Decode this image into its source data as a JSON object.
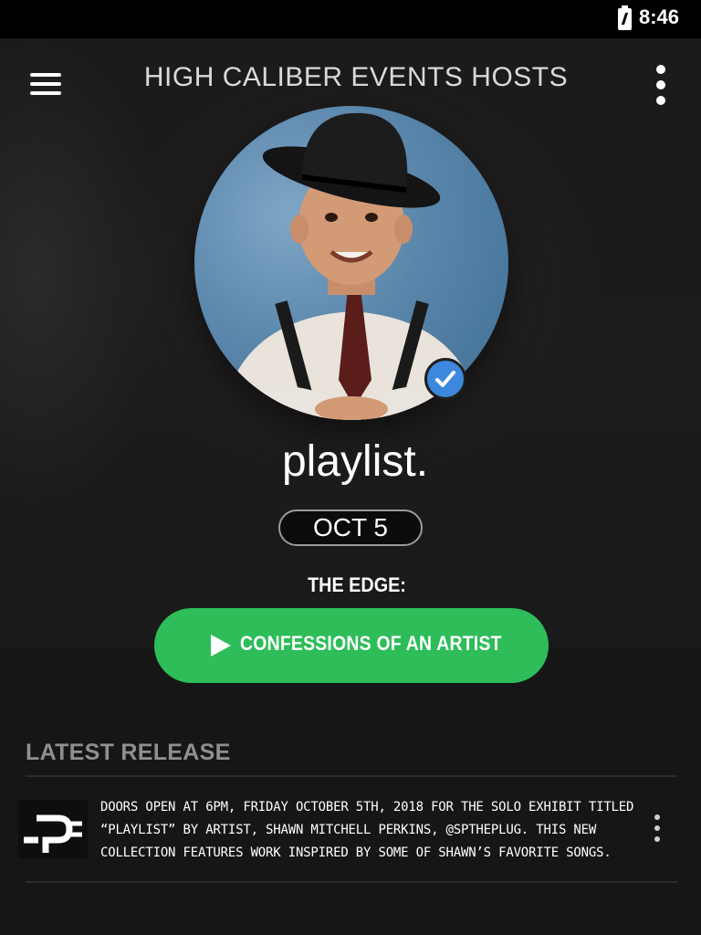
{
  "status_bar": {
    "time": "8:46",
    "battery_icon": "battery-charging-icon"
  },
  "toolbar": {
    "title": "HIGH CALIBER EVENTS HOSTS",
    "menu_icon": "hamburger-menu-icon",
    "more_icon": "more-vertical-icon"
  },
  "profile": {
    "name": "playlist.",
    "verified": true,
    "date": "OCT 5",
    "venue": "THE EDGE:",
    "cta_label": "CONFESSIONS OF AN ARTIST",
    "cta_color": "#2ebd59",
    "verified_color": "#3d88dc"
  },
  "latest_release": {
    "section_title": "LATEST RELEASE",
    "item": {
      "description": "Doors open at 6PM, friday october 5th, 2018 for the solo exhibit titled “playlist” by artist, Shawn Mitchell Perkins, @sptheplug. This new collection features work inspired by some of Shawn’s favorite songs."
    }
  }
}
